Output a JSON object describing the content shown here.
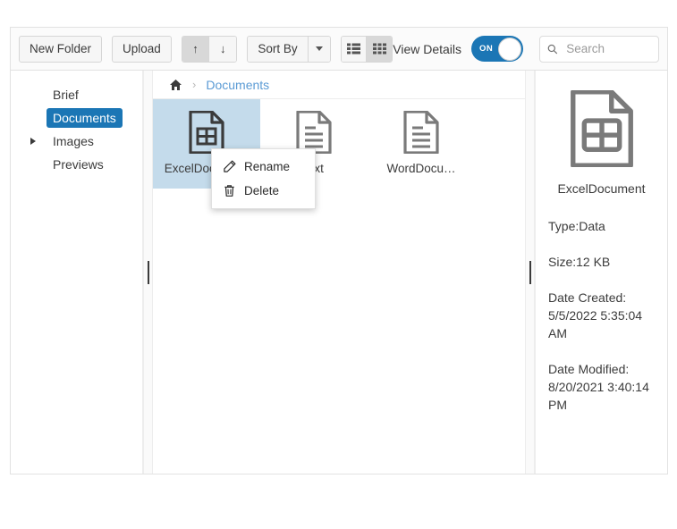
{
  "toolbar": {
    "new_folder_label": "New Folder",
    "upload_label": "Upload",
    "sort_asc_icon": "arrow-up-icon",
    "sort_desc_icon": "arrow-down-icon",
    "sort_asc_glyph": "↑",
    "sort_desc_glyph": "↓",
    "sort_by_label": "Sort By",
    "view_list_icon": "list-view-icon",
    "view_grid_icon": "grid-view-icon",
    "view_details_label": "View Details",
    "toggle_state_label": "ON",
    "search_icon": "search-icon",
    "search_placeholder": "Search",
    "search_value": ""
  },
  "sidebar": {
    "items": [
      {
        "label": "Brief",
        "selected": false,
        "expandable": false
      },
      {
        "label": "Documents",
        "selected": true,
        "expandable": false
      },
      {
        "label": "Images",
        "selected": false,
        "expandable": true
      },
      {
        "label": "Previews",
        "selected": false,
        "expandable": false
      }
    ]
  },
  "breadcrumb": {
    "home_icon": "home-icon",
    "separator": "›",
    "current": "Documents"
  },
  "files": [
    {
      "name": "ExcelDocument",
      "icon": "excel-file-icon",
      "selected": true
    },
    {
      "name": "t.txt",
      "icon": "text-file-icon",
      "selected": false
    },
    {
      "name": "WordDocu…",
      "icon": "word-file-icon",
      "selected": false
    }
  ],
  "context_menu": {
    "items": [
      {
        "label": "Rename",
        "icon": "pencil-icon"
      },
      {
        "label": "Delete",
        "icon": "trash-icon"
      }
    ]
  },
  "details": {
    "icon": "excel-file-icon",
    "name": "ExcelDocument",
    "type": "Type:Data",
    "size": "Size:12 KB",
    "date_created": "Date Created: 5/5/2022 5:35:04 AM",
    "date_modified": "Date Modified: 8/20/2021 3:40:14 PM"
  },
  "colors": {
    "accent": "#1b76b5",
    "selection": "#c4dbeb",
    "link": "#5b9bd5",
    "icon_gray": "#7a7a7a",
    "icon_dark": "#3b3b3b"
  }
}
